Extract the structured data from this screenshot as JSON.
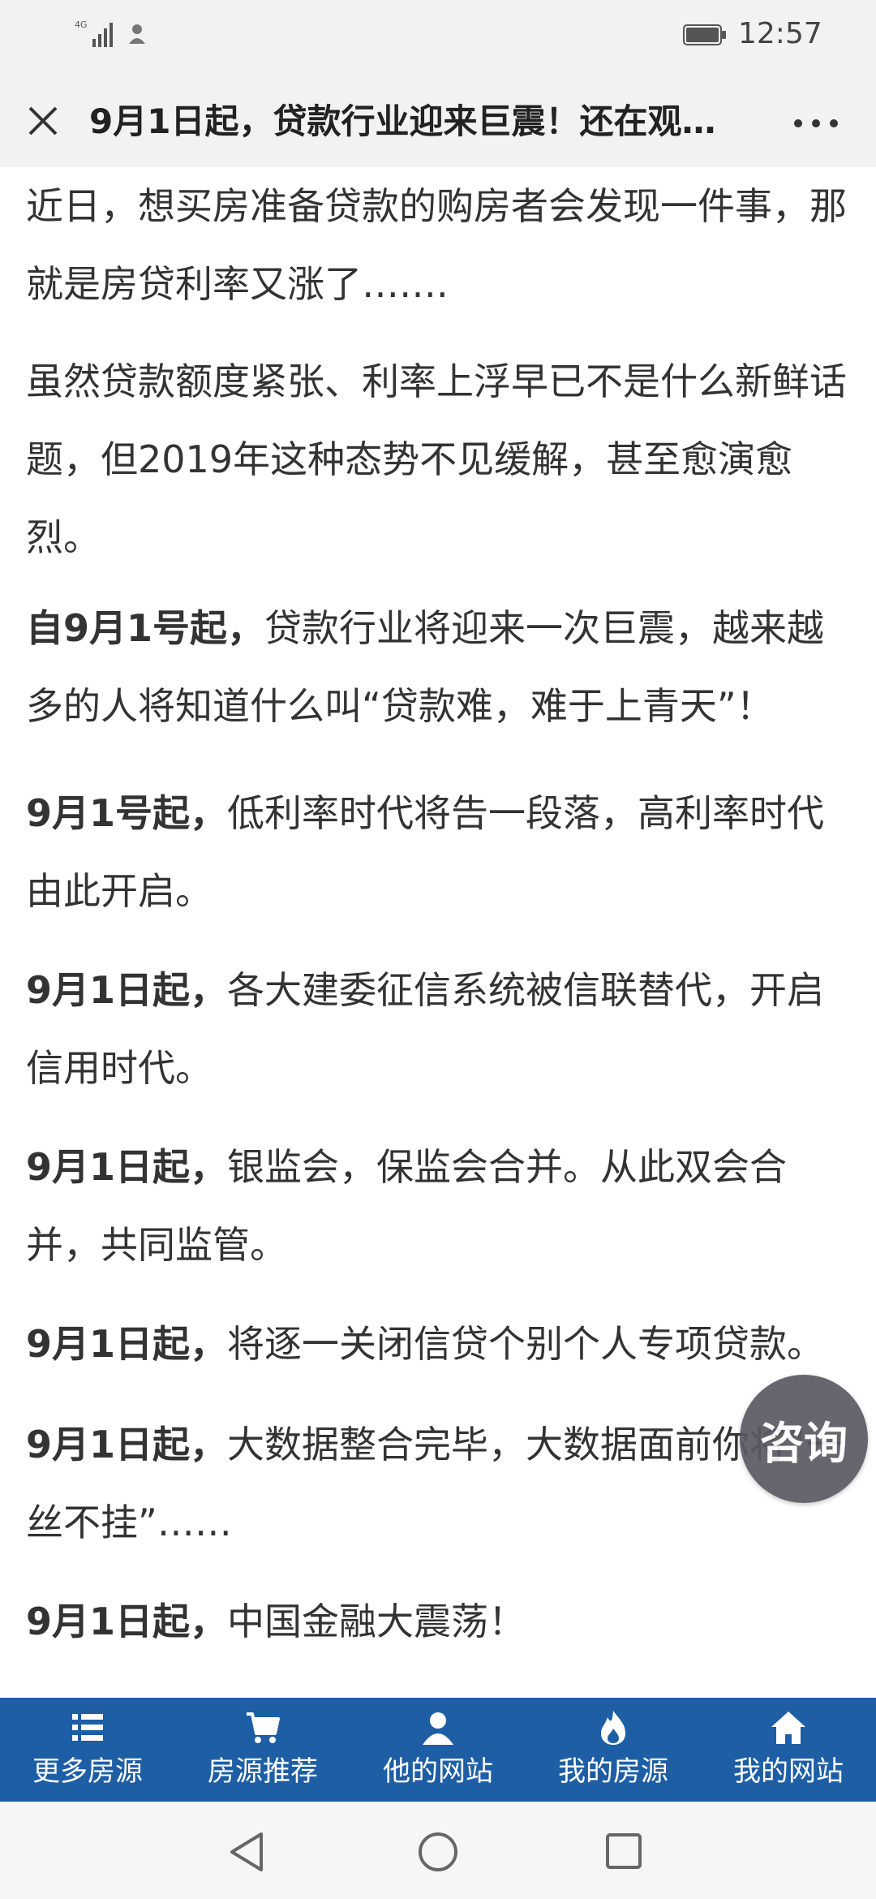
{
  "status_bar": {
    "network_label": "4G",
    "time": "12:57"
  },
  "header": {
    "title": "9月1日起，贷款行业迎来巨震！还在观…"
  },
  "article": {
    "paragraphs": [
      {
        "bold": "",
        "text": "近日，想买房准备贷款的购房者会发现一件事，那就是房贷利率又涨了……."
      },
      {
        "bold": "",
        "text": "虽然贷款额度紧张、利率上浮早已不是什么新鲜话题，但2019年这种态势不见缓解，甚至愈演愈烈。"
      },
      {
        "bold": "自9月1号起，",
        "text": "贷款行业将迎来一次巨震，越来越多的人将知道什么叫“贷款难，难于上青天”！"
      },
      {
        "bold": "9月1号起，",
        "text": "低利率时代将告一段落，高利率时代由此开启。"
      },
      {
        "bold": "9月1日起，",
        "text": "各大建委征信系统被信联替代，开启信用时代。"
      },
      {
        "bold": "9月1日起，",
        "text": "银监会，保监会合并。从此双会合并，共同监管。"
      },
      {
        "bold": "9月1日起，",
        "text": "将逐一关闭信贷个别个人专项贷款。"
      },
      {
        "bold": "9月1日起，",
        "text": "大数据整合完毕，大数据面前你将“一丝不挂”……"
      },
      {
        "bold": "9月1日起，",
        "text": "中国金融大震荡！"
      }
    ]
  },
  "consult_button": {
    "label": "咨询"
  },
  "bottom_nav": {
    "items": [
      {
        "label": "更多房源",
        "icon": "list-icon"
      },
      {
        "label": "房源推荐",
        "icon": "cart-icon"
      },
      {
        "label": "他的网站",
        "icon": "user-icon"
      },
      {
        "label": "我的房源",
        "icon": "flame-icon"
      },
      {
        "label": "我的网站",
        "icon": "home-icon"
      }
    ]
  },
  "colors": {
    "nav_background": "#1e5ea5",
    "consult_background": "#5b5961"
  }
}
